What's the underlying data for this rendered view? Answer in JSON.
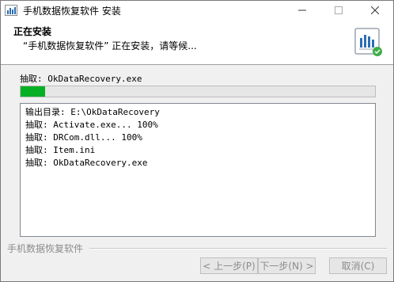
{
  "window": {
    "title": "手机数据恢复软件 安装",
    "controls": {
      "minimize_icon": "minimize-icon",
      "maximize_icon": "maximize-icon",
      "close_icon": "close-icon"
    }
  },
  "header": {
    "title": "正在安装",
    "subtitle": "“手机数据恢复软件” 正在安装，请等候..."
  },
  "status_line": "抽取: OkDataRecovery.exe",
  "progress": {
    "fraction": 0.07,
    "color": "#06b025"
  },
  "log_lines": [
    "输出目录: E:\\OkDataRecovery",
    "抽取: Activate.exe... 100%",
    "抽取: DRCom.dll... 100%",
    "抽取: Item.ini",
    "抽取: OkDataRecovery.exe"
  ],
  "footer": {
    "brand": "手机数据恢复软件",
    "back_label": "< 上一步(P)",
    "next_label": "下一步(N) >",
    "cancel_label": "取消(C)"
  }
}
